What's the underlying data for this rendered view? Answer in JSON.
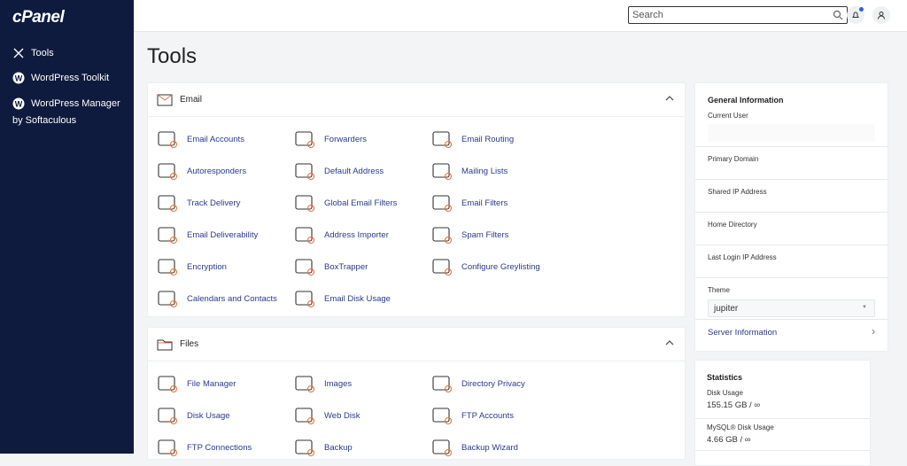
{
  "sidebar": {
    "logo": "cPanel",
    "items": [
      {
        "label": "Tools",
        "icon": "tools-icon"
      },
      {
        "label": "WordPress Toolkit",
        "icon": "wordpress-icon"
      },
      {
        "label": "WordPress Manager",
        "sub": "by Softaculous",
        "icon": "wordpress-icon"
      }
    ]
  },
  "topbar": {
    "search_placeholder": "Search"
  },
  "page_title": "Tools",
  "email": {
    "title": "Email",
    "items": [
      "Email Accounts",
      "Forwarders",
      "Email Routing",
      "Autoresponders",
      "Default Address",
      "Mailing Lists",
      "Track Delivery",
      "Global Email Filters",
      "Email Filters",
      "Email Deliverability",
      "Address Importer",
      "Spam Filters",
      "Encryption",
      "BoxTrapper",
      "Configure Greylisting",
      "Calendars and Contacts",
      "Email Disk Usage"
    ]
  },
  "files": {
    "title": "Files",
    "items": [
      "File Manager",
      "Images",
      "Directory Privacy",
      "Disk Usage",
      "Web Disk",
      "FTP Accounts",
      "FTP Connections",
      "Backup",
      "Backup Wizard"
    ]
  },
  "general": {
    "title": "General Information",
    "current_user": "Current User",
    "primary_domain": "Primary Domain",
    "shared_ip": "Shared IP Address",
    "home_dir": "Home Directory",
    "last_login": "Last Login IP Address",
    "theme_label": "Theme",
    "theme_value": "jupiter",
    "server_info": "Server Information"
  },
  "stats": {
    "title": "Statistics",
    "disk_label": "Disk Usage",
    "disk_value": "155.15 GB / ∞",
    "mysql_label": "MySQL® Disk Usage",
    "mysql_value": "4.66 GB / ∞"
  },
  "colors": {
    "sidebar": "#0f1b3e",
    "link": "#2b3a8a",
    "accent": "#e8743b"
  }
}
